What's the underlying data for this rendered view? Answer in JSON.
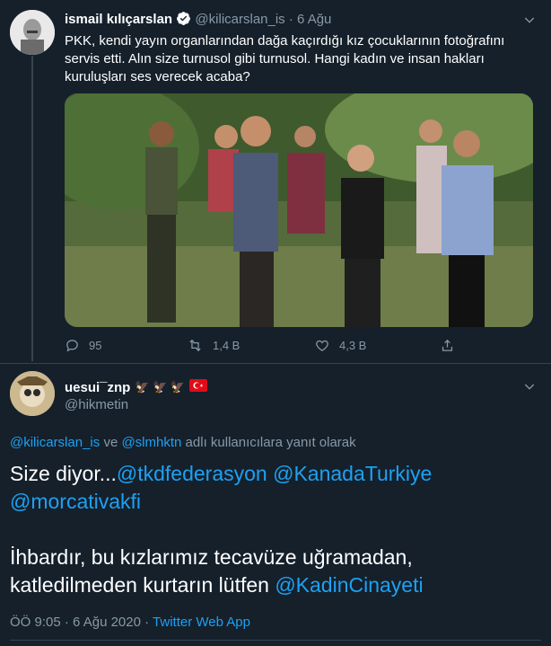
{
  "original_tweet": {
    "author_name": "ismail kılıçarslan",
    "handle": "@kilicarslan_is",
    "separator": "·",
    "date": "6 Ağu",
    "text": "PKK, kendi yayın organlarından dağa kaçırdığı kız çocuklarının fotoğrafını servis etti. Alın size turnusol gibi turnusol. Hangi kadın ve insan hakları kuruluşları ses verecek acaba?",
    "replies": "95",
    "retweets": "1,4 B",
    "likes": "4,3 B"
  },
  "reply_tweet": {
    "author_name": "uesui¯znp",
    "name_emojis": "🦅 🦅 🦅",
    "handle": "@hikmetin",
    "reply_prefix_user1": "@kilicarslan_is",
    "reply_prefix_and": "ve",
    "reply_prefix_user2": "@slmhktn",
    "reply_prefix_suffix": "adlı kullanıcılara yanıt olarak",
    "body_line1_text": "Size diyor...",
    "mention1": "@tkdfederasyon",
    "mention2": "@KanadaTurkiye",
    "mention3": "@morcativakfi",
    "body_line3_text": "İhbardır, bu kızlarımız tecavüze uğramadan, katledilmeden kurtarın lütfen",
    "mention4": "@KadinCinayeti",
    "time": "ÖÖ 9:05",
    "date": "6 Ağu 2020",
    "meta_sep": "·",
    "source": "Twitter Web App"
  },
  "colors": {
    "background": "#15202b",
    "accent": "#1da1f2",
    "secondary_text": "#8899a6",
    "divider": "#38444d"
  }
}
